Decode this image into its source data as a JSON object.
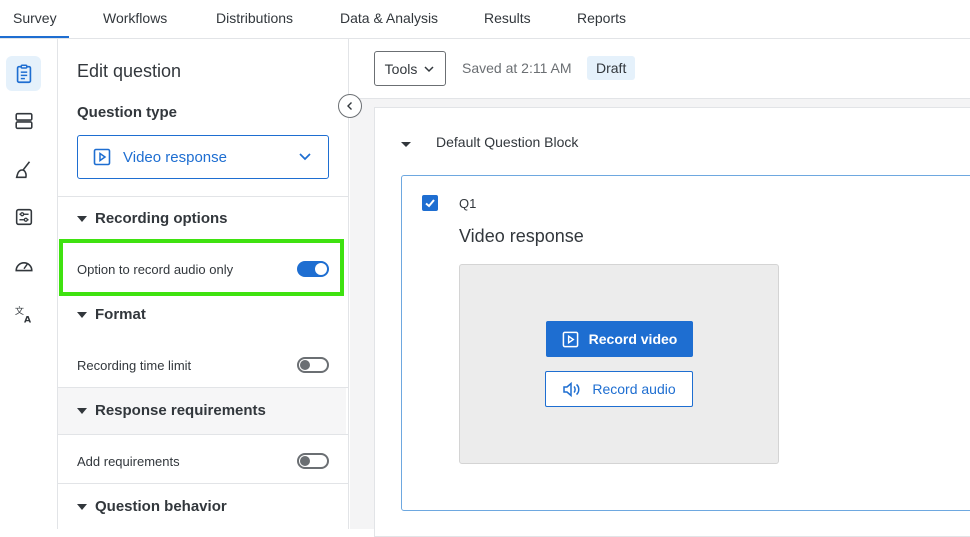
{
  "nav": {
    "tabs": [
      {
        "label": "Survey"
      },
      {
        "label": "Workflows"
      },
      {
        "label": "Distributions"
      },
      {
        "label": "Data & Analysis"
      },
      {
        "label": "Results"
      },
      {
        "label": "Reports"
      }
    ]
  },
  "rail": {
    "icons": [
      "clipboard-icon",
      "layout-icon",
      "brush-icon",
      "sliders-icon",
      "gauge-icon",
      "translate-icon"
    ]
  },
  "panel": {
    "title": "Edit question",
    "question_type_label": "Question type",
    "question_type_value": "Video response",
    "sections": {
      "recording_options": "Recording options",
      "format": "Format",
      "response_requirements": "Response requirements",
      "question_behavior": "Question behavior"
    },
    "options": {
      "audio_only": {
        "label": "Option to record audio only",
        "enabled": true
      },
      "time_limit": {
        "label": "Recording time limit",
        "enabled": false
      },
      "add_requirements": {
        "label": "Add requirements",
        "enabled": false
      }
    }
  },
  "toolbar": {
    "tools_label": "Tools",
    "saved_text": "Saved at 2:11 AM",
    "status_badge": "Draft"
  },
  "block": {
    "title": "Default Question Block",
    "question": {
      "number": "Q1",
      "text": "Video response",
      "checked": true,
      "record_video_label": "Record video",
      "record_audio_label": "Record audio"
    }
  },
  "colors": {
    "accent": "#1e6ed1",
    "highlight": "#3fe210"
  }
}
